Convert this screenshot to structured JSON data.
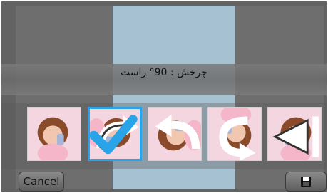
{
  "dialog": {
    "title": "چرخش : 90° راست"
  },
  "thumbnails": [
    {
      "name": "original"
    },
    {
      "name": "rotate-right-90",
      "selected": true
    },
    {
      "name": "rotate-left-90"
    },
    {
      "name": "rotate-180"
    },
    {
      "name": "flip-horizontal"
    }
  ],
  "buttons": {
    "cancel_label": "Cancel",
    "save_icon": "save-icon"
  },
  "colors": {
    "selection": "#29a4e8",
    "background": "#6d6d6d",
    "photo_bg": "#bfe0f4"
  }
}
